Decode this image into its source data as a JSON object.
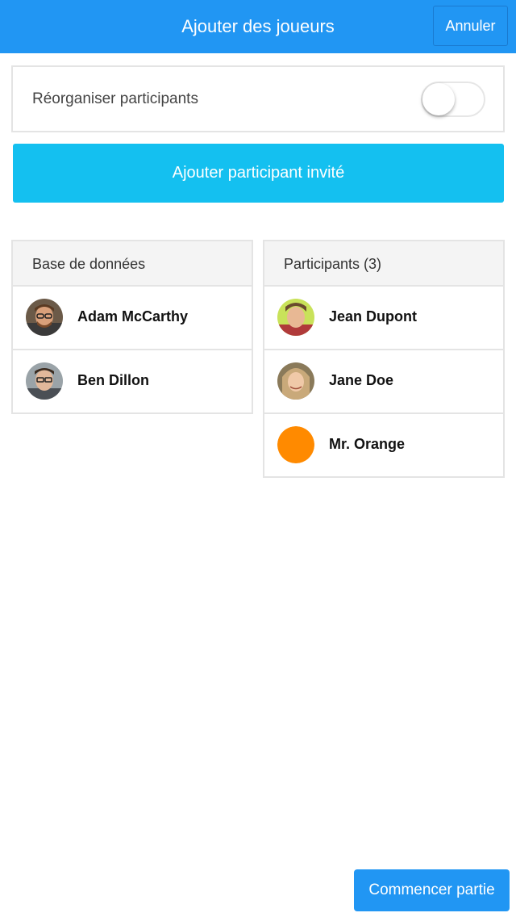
{
  "header": {
    "title": "Ajouter des joueurs",
    "cancel_label": "Annuler"
  },
  "reorder": {
    "label": "Réorganiser participants",
    "enabled": false
  },
  "add_guest_label": "Ajouter participant invité",
  "database": {
    "title": "Base de données",
    "players": [
      {
        "name": "Adam McCarthy"
      },
      {
        "name": "Ben Dillon"
      }
    ]
  },
  "participants": {
    "title": "Participants (3)",
    "players": [
      {
        "name": "Jean Dupont"
      },
      {
        "name": "Jane Doe"
      },
      {
        "name": "Mr. Orange",
        "avatar_color": "#ff8a00"
      }
    ]
  },
  "start_label": "Commencer partie",
  "colors": {
    "header": "#2196f3",
    "add_guest": "#14c0f0",
    "start": "#2196f3",
    "orange_avatar": "#ff8a00"
  }
}
